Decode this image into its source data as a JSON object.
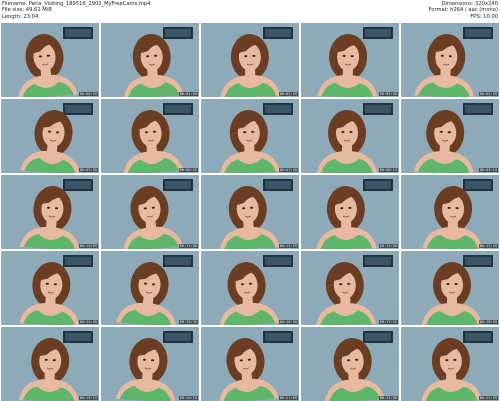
{
  "header": {
    "filename_label": "Filename:",
    "filename": "Perla_Visiting_189516_2902_MyFreeCams.mp4",
    "filesize_label": "File size:",
    "filesize": "49.61 MiB",
    "length_label": "Length:",
    "length": "23:04",
    "dimensions_label": "Dimensions:",
    "dimensions": "320x240",
    "format_label": "Format:",
    "format": "h264 / aac (mono)",
    "fps_label": "FPS:",
    "fps": "10.00"
  },
  "thumbnails": [
    {
      "timestamp": "00:00:55"
    },
    {
      "timestamp": "00:01:50"
    },
    {
      "timestamp": "00:02:45"
    },
    {
      "timestamp": "00:03:40"
    },
    {
      "timestamp": "00:04:35"
    },
    {
      "timestamp": "00:05:30"
    },
    {
      "timestamp": "00:06:25"
    },
    {
      "timestamp": "00:07:20"
    },
    {
      "timestamp": "00:08:15"
    },
    {
      "timestamp": "00:09:10"
    },
    {
      "timestamp": "00:10:05"
    },
    {
      "timestamp": "00:11:00"
    },
    {
      "timestamp": "00:11:55"
    },
    {
      "timestamp": "00:12:50"
    },
    {
      "timestamp": "00:13:45"
    },
    {
      "timestamp": "00:14:40"
    },
    {
      "timestamp": "00:15:35"
    },
    {
      "timestamp": "00:16:30"
    },
    {
      "timestamp": "00:17:25"
    },
    {
      "timestamp": "00:18:20"
    },
    {
      "timestamp": "00:19:15"
    },
    {
      "timestamp": "00:20:10"
    },
    {
      "timestamp": "00:21:05"
    },
    {
      "timestamp": "00:22:00"
    },
    {
      "timestamp": "00:22:55"
    }
  ],
  "colors": {
    "wall": "#8eaab8",
    "shirt": "#5fb56a",
    "hair": "#6b3d22",
    "skin": "#e7b9a0",
    "poster": "#223340"
  }
}
